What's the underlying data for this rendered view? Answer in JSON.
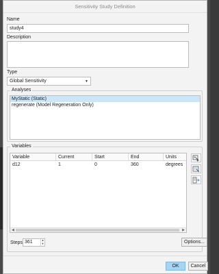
{
  "window": {
    "title": "Sensitivity Study Definition"
  },
  "name": {
    "label": "Name",
    "value": "study4"
  },
  "description": {
    "label": "Description",
    "value": ""
  },
  "type": {
    "label": "Type",
    "value": "Global Sensitivity"
  },
  "analyses": {
    "title": "Analyses",
    "items": [
      "MyStatic (Static)",
      "regenerate (Model Regeneration Only)"
    ]
  },
  "variables": {
    "title": "Variables",
    "columns": [
      "Variable",
      "Current",
      "Start",
      "End",
      "Units"
    ],
    "rows": [
      [
        "d12",
        "1",
        "0",
        "360",
        "degrees"
      ]
    ]
  },
  "steps": {
    "label": "Steps",
    "value": "361"
  },
  "buttons": {
    "options": "Options...",
    "ok": "OK",
    "cancel": "Cancel"
  }
}
